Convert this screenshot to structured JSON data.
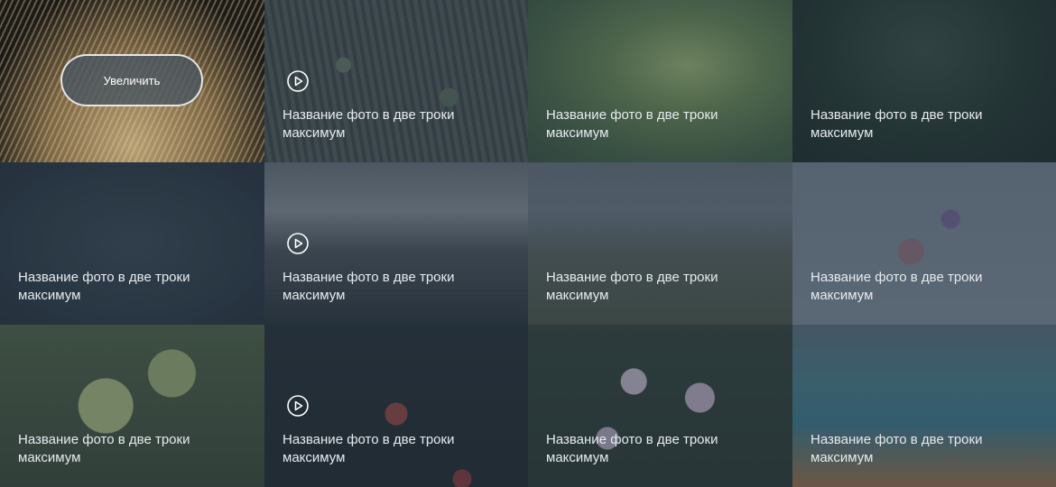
{
  "zoom_button_label": "Увеличить",
  "tiles": [
    {
      "caption": "",
      "has_play": false
    },
    {
      "caption": "Название фото в две троки максимум",
      "has_play": true
    },
    {
      "caption": "Название фото в две троки максимум",
      "has_play": false
    },
    {
      "caption": "Название фото в две троки максимум",
      "has_play": false
    },
    {
      "caption": "Название фото в две троки максимум",
      "has_play": false
    },
    {
      "caption": "Название фото в две троки максимум",
      "has_play": true
    },
    {
      "caption": "Название фото в две троки максимум",
      "has_play": false
    },
    {
      "caption": "Название фото в две троки максимум",
      "has_play": false
    },
    {
      "caption": "Название фото в две троки максимум",
      "has_play": false
    },
    {
      "caption": "Название фото в две троки максимум",
      "has_play": true
    },
    {
      "caption": "Название фото в две троки максимум",
      "has_play": false
    },
    {
      "caption": "Название фото в две троки максимум",
      "has_play": false
    }
  ]
}
